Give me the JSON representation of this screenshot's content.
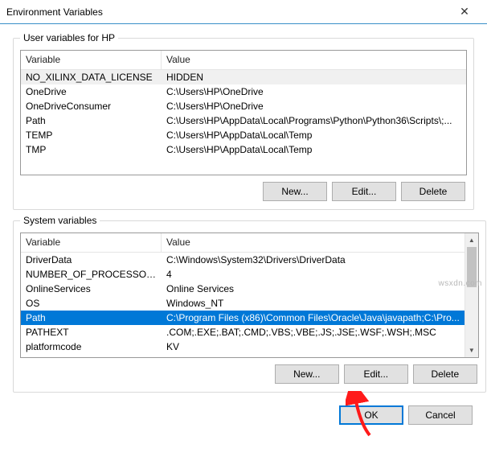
{
  "window": {
    "title": "Environment Variables",
    "close_glyph": "✕"
  },
  "user_section": {
    "legend": "User variables for HP",
    "header_var": "Variable",
    "header_val": "Value",
    "rows": [
      {
        "var": "NO_XILINX_DATA_LICENSE",
        "val": "HIDDEN",
        "sel": "gray"
      },
      {
        "var": "OneDrive",
        "val": "C:\\Users\\HP\\OneDrive"
      },
      {
        "var": "OneDriveConsumer",
        "val": "C:\\Users\\HP\\OneDrive"
      },
      {
        "var": "Path",
        "val": "C:\\Users\\HP\\AppData\\Local\\Programs\\Python\\Python36\\Scripts\\;..."
      },
      {
        "var": "TEMP",
        "val": "C:\\Users\\HP\\AppData\\Local\\Temp"
      },
      {
        "var": "TMP",
        "val": "C:\\Users\\HP\\AppData\\Local\\Temp"
      }
    ],
    "buttons": {
      "new": "New...",
      "edit": "Edit...",
      "delete": "Delete"
    }
  },
  "system_section": {
    "legend": "System variables",
    "header_var": "Variable",
    "header_val": "Value",
    "rows": [
      {
        "var": "DriverData",
        "val": "C:\\Windows\\System32\\Drivers\\DriverData"
      },
      {
        "var": "NUMBER_OF_PROCESSORS",
        "val": "4"
      },
      {
        "var": "OnlineServices",
        "val": "Online Services"
      },
      {
        "var": "OS",
        "val": "Windows_NT"
      },
      {
        "var": "Path",
        "val": "C:\\Program Files (x86)\\Common Files\\Oracle\\Java\\javapath;C:\\Pro...",
        "sel": "blue"
      },
      {
        "var": "PATHEXT",
        "val": ".COM;.EXE;.BAT;.CMD;.VBS;.VBE;.JS;.JSE;.WSF;.WSH;.MSC"
      },
      {
        "var": "platformcode",
        "val": "KV"
      }
    ],
    "buttons": {
      "new": "New...",
      "edit": "Edit...",
      "delete": "Delete"
    },
    "scroll_glyph_up": "▲",
    "scroll_glyph_down": "▼"
  },
  "footer": {
    "ok": "OK",
    "cancel": "Cancel"
  },
  "watermark": "wsxdn.com"
}
